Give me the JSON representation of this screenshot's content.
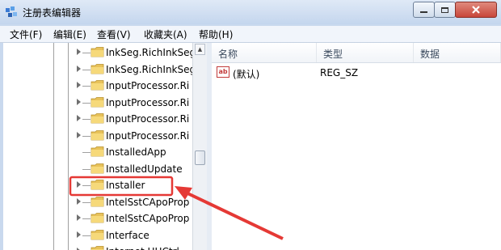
{
  "window": {
    "title": "注册表编辑器",
    "controls": {
      "minimize_icon": "minimize-icon",
      "maximize_icon": "maximize-icon",
      "close_icon": "close-icon"
    },
    "colors": {
      "close": "#c8463a",
      "highlight": "#e53935"
    }
  },
  "menu": {
    "items": [
      {
        "label": "文件(F)"
      },
      {
        "label": "编辑(E)"
      },
      {
        "label": "查看(V)"
      },
      {
        "label": "收藏夹(A)"
      },
      {
        "label": "帮助(H)"
      }
    ]
  },
  "tree": {
    "nodes": [
      {
        "label": "InkSeg.RichInkSeg",
        "expandable": true
      },
      {
        "label": "InkSeg.RichInkSeg",
        "expandable": true
      },
      {
        "label": "InputProcessor.Ri",
        "expandable": true
      },
      {
        "label": "InputProcessor.Ri",
        "expandable": true
      },
      {
        "label": "InputProcessor.Ri",
        "expandable": true
      },
      {
        "label": "InputProcessor.Ri",
        "expandable": true
      },
      {
        "label": "InstalledApp",
        "expandable": false
      },
      {
        "label": "InstalledUpdate",
        "expandable": false
      },
      {
        "label": "Installer",
        "expandable": true,
        "highlighted": true
      },
      {
        "label": "IntelSstCApoProp",
        "expandable": true
      },
      {
        "label": "IntelSstCApoProp",
        "expandable": true
      },
      {
        "label": "Interface",
        "expandable": true
      },
      {
        "label": "Internet.HHCtrl",
        "expandable": true
      }
    ]
  },
  "list": {
    "columns": [
      "名称",
      "类型",
      "数据"
    ],
    "rows": [
      {
        "icon": "ab",
        "name": "(默认)",
        "type": "REG_SZ",
        "data": ""
      }
    ]
  }
}
